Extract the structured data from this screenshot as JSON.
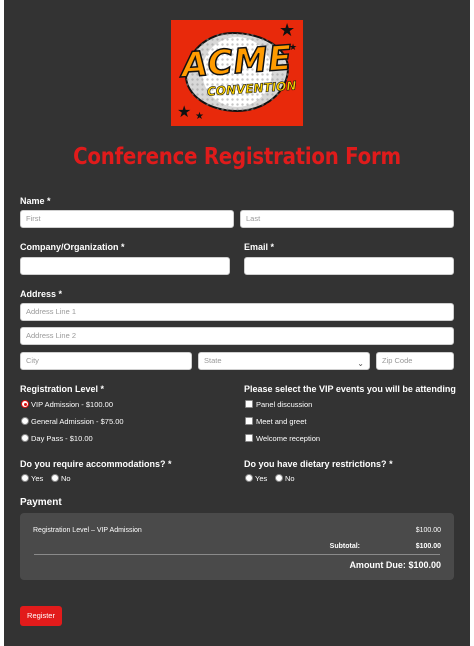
{
  "logo": {
    "line1": "ACME",
    "line2": "CONVENTION"
  },
  "form_title": "Conference Registration Form",
  "name": {
    "label": "Name",
    "required": "*",
    "first_placeholder": "First",
    "last_placeholder": "Last"
  },
  "company": {
    "label": "Company/Organization",
    "required": "*"
  },
  "email": {
    "label": "Email",
    "required": "*"
  },
  "address": {
    "label": "Address",
    "required": "*",
    "line1_placeholder": "Address Line 1",
    "line2_placeholder": "Address Line 2",
    "city_placeholder": "City",
    "state_placeholder": "State",
    "zip_placeholder": "Zip Code"
  },
  "registration_level": {
    "label": "Registration Level",
    "required": "*",
    "options": [
      "VIP Admission - $100.00",
      "General Admission - $75.00",
      "Day Pass - $10.00"
    ],
    "selected": "VIP Admission - $100.00"
  },
  "vip_events": {
    "label": "Please select the VIP events you will be attending",
    "options": [
      "Panel discussion",
      "Meet and greet",
      "Welcome reception"
    ]
  },
  "accommodations": {
    "label": "Do you require accommodations?",
    "required": "*",
    "options": [
      "Yes",
      "No"
    ]
  },
  "dietary": {
    "label": "Do you have dietary restrictions?",
    "required": "*",
    "options": [
      "Yes",
      "No"
    ]
  },
  "payment": {
    "title": "Payment",
    "item_label": "Registration Level – VIP Admission",
    "item_amount": "$100.00",
    "subtotal_label": "Subtotal:",
    "subtotal_amount": "$100.00",
    "amount_due_label": "Amount Due:",
    "amount_due": "$100.00"
  },
  "register_button": "Register",
  "colors": {
    "page_bg": "#333333",
    "accent": "#e01b1b",
    "payment_bg": "#4a4a4a"
  }
}
